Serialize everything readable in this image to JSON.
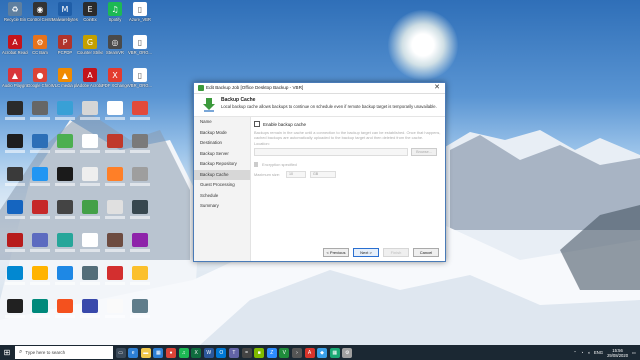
{
  "desktop_icons": [
    {
      "label": "Recycle Bin",
      "icon": "recycle-bin-icon",
      "color": "#5f7f9f",
      "glyph": "♻"
    },
    {
      "label": "Control Centre",
      "icon": "control-centre-icon",
      "color": "#333333",
      "glyph": "◉"
    },
    {
      "label": "Malwarebytes OEE",
      "icon": "malwarebytes-icon",
      "color": "#1f5ea8",
      "glyph": "M"
    },
    {
      "label": "CoinEx",
      "icon": "coinex-icon",
      "color": "#2b2b2b",
      "glyph": "E"
    },
    {
      "label": "Spotify",
      "icon": "spotify-icon",
      "color": "#1db954",
      "glyph": "♫"
    },
    {
      "label": "Azure_VBR",
      "icon": "azure-vbr-icon",
      "color": "#ffffff",
      "glyph": "▯"
    },
    {
      "label": "Acrobat Reader DC",
      "icon": "acrobat-icon",
      "color": "#c4141b",
      "glyph": "A"
    },
    {
      "label": "CC Bam",
      "icon": "ccbam-icon",
      "color": "#e6731c",
      "glyph": "⚙"
    },
    {
      "label": "PCPDP",
      "icon": "pcpdp-icon",
      "color": "#b0342c",
      "glyph": "P"
    },
    {
      "label": "Counter Strike Global Offen",
      "icon": "csgo-icon",
      "color": "#c4a000",
      "glyph": "G"
    },
    {
      "label": "SteamVR",
      "icon": "steamvr-icon",
      "color": "#4a4a4a",
      "glyph": "◎"
    },
    {
      "label": "VBR_ORG...",
      "icon": "vbr-org-icon",
      "color": "#ffffff",
      "glyph": "▯"
    },
    {
      "label": "Audio Playground",
      "icon": "audio-icon",
      "color": "#d8363a",
      "glyph": "▲"
    },
    {
      "label": "Google Chrome",
      "icon": "chrome-icon",
      "color": "#db4437",
      "glyph": "●"
    },
    {
      "label": "VLC media player",
      "icon": "vlc-icon",
      "color": "#f08a00",
      "glyph": "▲"
    },
    {
      "label": "Adobe Acrobat",
      "icon": "adobe-acrobat-icon",
      "color": "#c4141b",
      "glyph": "A"
    },
    {
      "label": "PDF XChange",
      "icon": "pdfx-icon",
      "color": "#e33b2e",
      "glyph": "X"
    },
    {
      "label": "VBR_ORG...",
      "icon": "vbr-org2-icon",
      "color": "#ffffff",
      "glyph": "▯"
    }
  ],
  "dialog": {
    "title": "Edit Backup Job [Office Desktop Backup - VBR]",
    "header_title": "Backup Cache",
    "header_desc": "Local backup cache allows backups to continue on schedule even if remote backup target is temporarily unavailable.",
    "nav": [
      "Name",
      "Backup Mode",
      "Destination",
      "Backup Server",
      "Backup Repository",
      "Backup Cache",
      "Guest Processing",
      "Schedule",
      "Summary"
    ],
    "active_nav": "Backup Cache",
    "enable_label": "Enable backup cache",
    "help_text": "Backups remain in the cache until a connection to the backup target can be established. Once that happens, cached backups are automatically uploaded to the backup target and then deleted from the cache.",
    "location_label": "Location:",
    "browse_label": "Browse...",
    "encryption_label": "Encryption specified",
    "max_size_label": "Maximum size:",
    "max_size_value": "10",
    "max_size_unit": "GB",
    "buttons": {
      "previous": "< Previous",
      "next": "Next >",
      "finish": "Finish",
      "cancel": "Cancel"
    }
  },
  "taskbar": {
    "search_placeholder": "Type here to search",
    "time": "15:56",
    "date": "29/08/2020",
    "lang": "ENG"
  }
}
